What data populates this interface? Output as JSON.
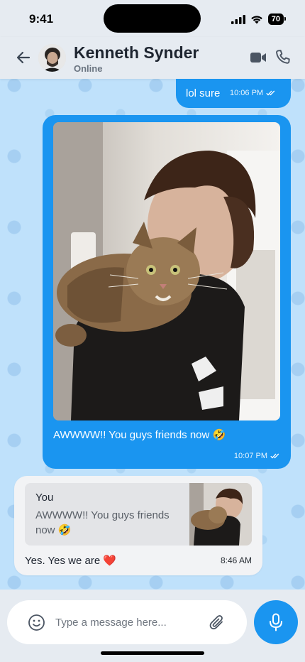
{
  "status": {
    "time": "9:41",
    "battery": "70"
  },
  "header": {
    "contact_name": "Kenneth Synder",
    "contact_status": "Online",
    "icons": {
      "back": "arrow-left-icon",
      "video": "video-camera-icon",
      "call": "phone-icon"
    }
  },
  "messages": [
    {
      "direction": "outgoing",
      "text": "lol sure",
      "time": "10:06 PM",
      "read": true
    },
    {
      "direction": "outgoing",
      "has_photo": true,
      "text": "AWWWW!! You guys friends now 🤣",
      "time": "10:07 PM",
      "read": true
    },
    {
      "direction": "incoming",
      "reply_to": {
        "sender": "You",
        "text": "AWWWW!! You guys friends now 🤣",
        "has_thumbnail": true
      },
      "text": "Yes. Yes we are ❤️",
      "time": "8:46 AM"
    }
  ],
  "composer": {
    "placeholder": "Type a message here...",
    "icons": {
      "emoji": "smiley-icon",
      "attach": "paperclip-icon",
      "mic": "microphone-icon"
    }
  },
  "colors": {
    "accent": "#1a95f0",
    "chat_background": "#bfe1fb",
    "bar_background": "#e6ebf1"
  }
}
